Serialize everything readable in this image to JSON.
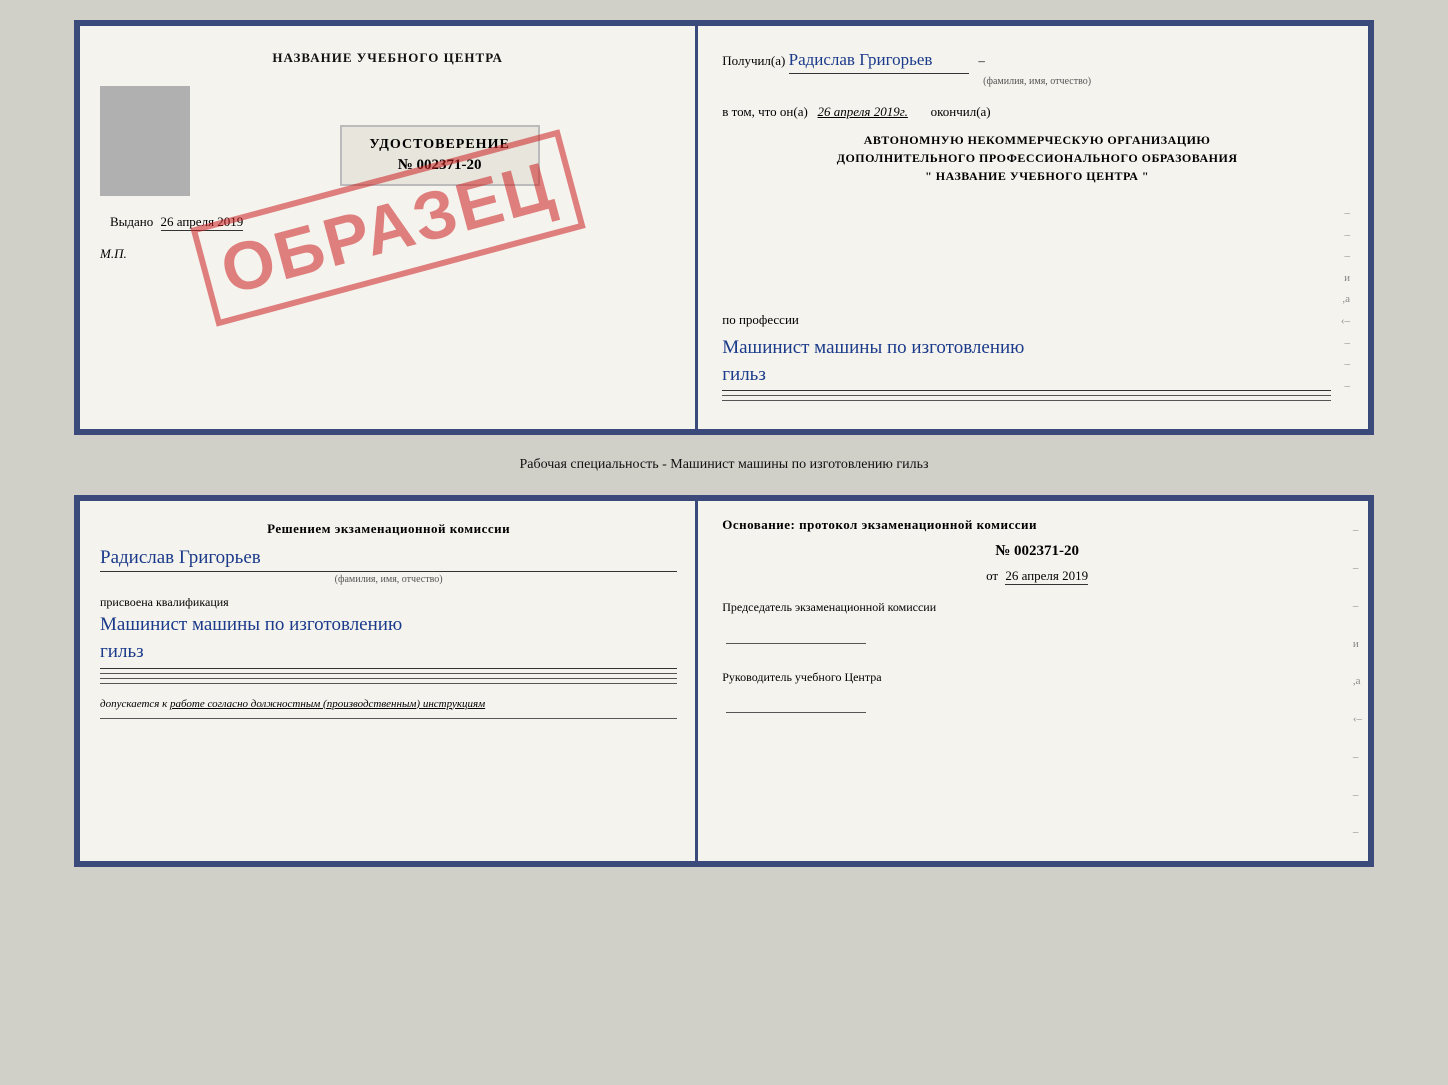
{
  "top_doc": {
    "left": {
      "header": "НАЗВАНИЕ УЧЕБНОГО ЦЕНТРА",
      "stamp": "ОБРАЗЕЦ",
      "udostoverenie_title": "УДОСТОВЕРЕНИЕ",
      "udostoverenie_number": "№ 002371-20",
      "vydano_label": "Выдано",
      "vydano_date": "26 апреля 2019",
      "mp_label": "М.П."
    },
    "right": {
      "poluchil_label": "Получил(а)",
      "poluchil_name": "Радислав Григорьев",
      "fio_sub": "(фамилия, имя, отчество)",
      "vtom_label": "в том, что он(а)",
      "vtom_date": "26 апреля 2019г.",
      "okonchil_label": "окончил(а)",
      "org_line1": "АВТОНОМНУЮ НЕКОММЕРЧЕСКУЮ ОРГАНИЗАЦИЮ",
      "org_line2": "ДОПОЛНИТЕЛЬНОГО ПРОФЕССИОНАЛЬНОГО ОБРАЗОВАНИЯ",
      "org_line3": "\"  НАЗВАНИЕ УЧЕБНОГО ЦЕНТРА  \"",
      "po_professii_label": "по профессии",
      "profession_text": "Машинист машины по изготовлению",
      "profession_text2": "гильз"
    }
  },
  "working_specialty": "Рабочая специальность - Машинист машины по изготовлению гильз",
  "bottom_doc": {
    "left": {
      "resheniem_label": "Решением  экзаменационной  комиссии",
      "name_handwritten": "Радислав Григорьев",
      "fio_sub": "(фамилия, имя, отчество)",
      "prisvoena_label": "присвоена квалификация",
      "qualification_text": "Машинист  машины  по  изготовлению",
      "qualification_text2": "гильз",
      "dopuskaetsya_label": "допускается к",
      "dopuskaetsya_text": "работе согласно должностным (производственным) инструкциям"
    },
    "right": {
      "osnovaniye_label": "Основание: протокол экзаменационной  комиссии",
      "proto_number": "№  002371-20",
      "ot_label": "от",
      "ot_date": "26 апреля 2019",
      "predsedatel_label": "Председатель экзаменационной комиссии",
      "rukovoditel_label": "Руководитель учебного Центра"
    }
  },
  "edge_marks": {
    "marks": [
      "–",
      "–",
      "–",
      "и",
      ",а",
      "‹–",
      "–",
      "–",
      "–"
    ]
  }
}
